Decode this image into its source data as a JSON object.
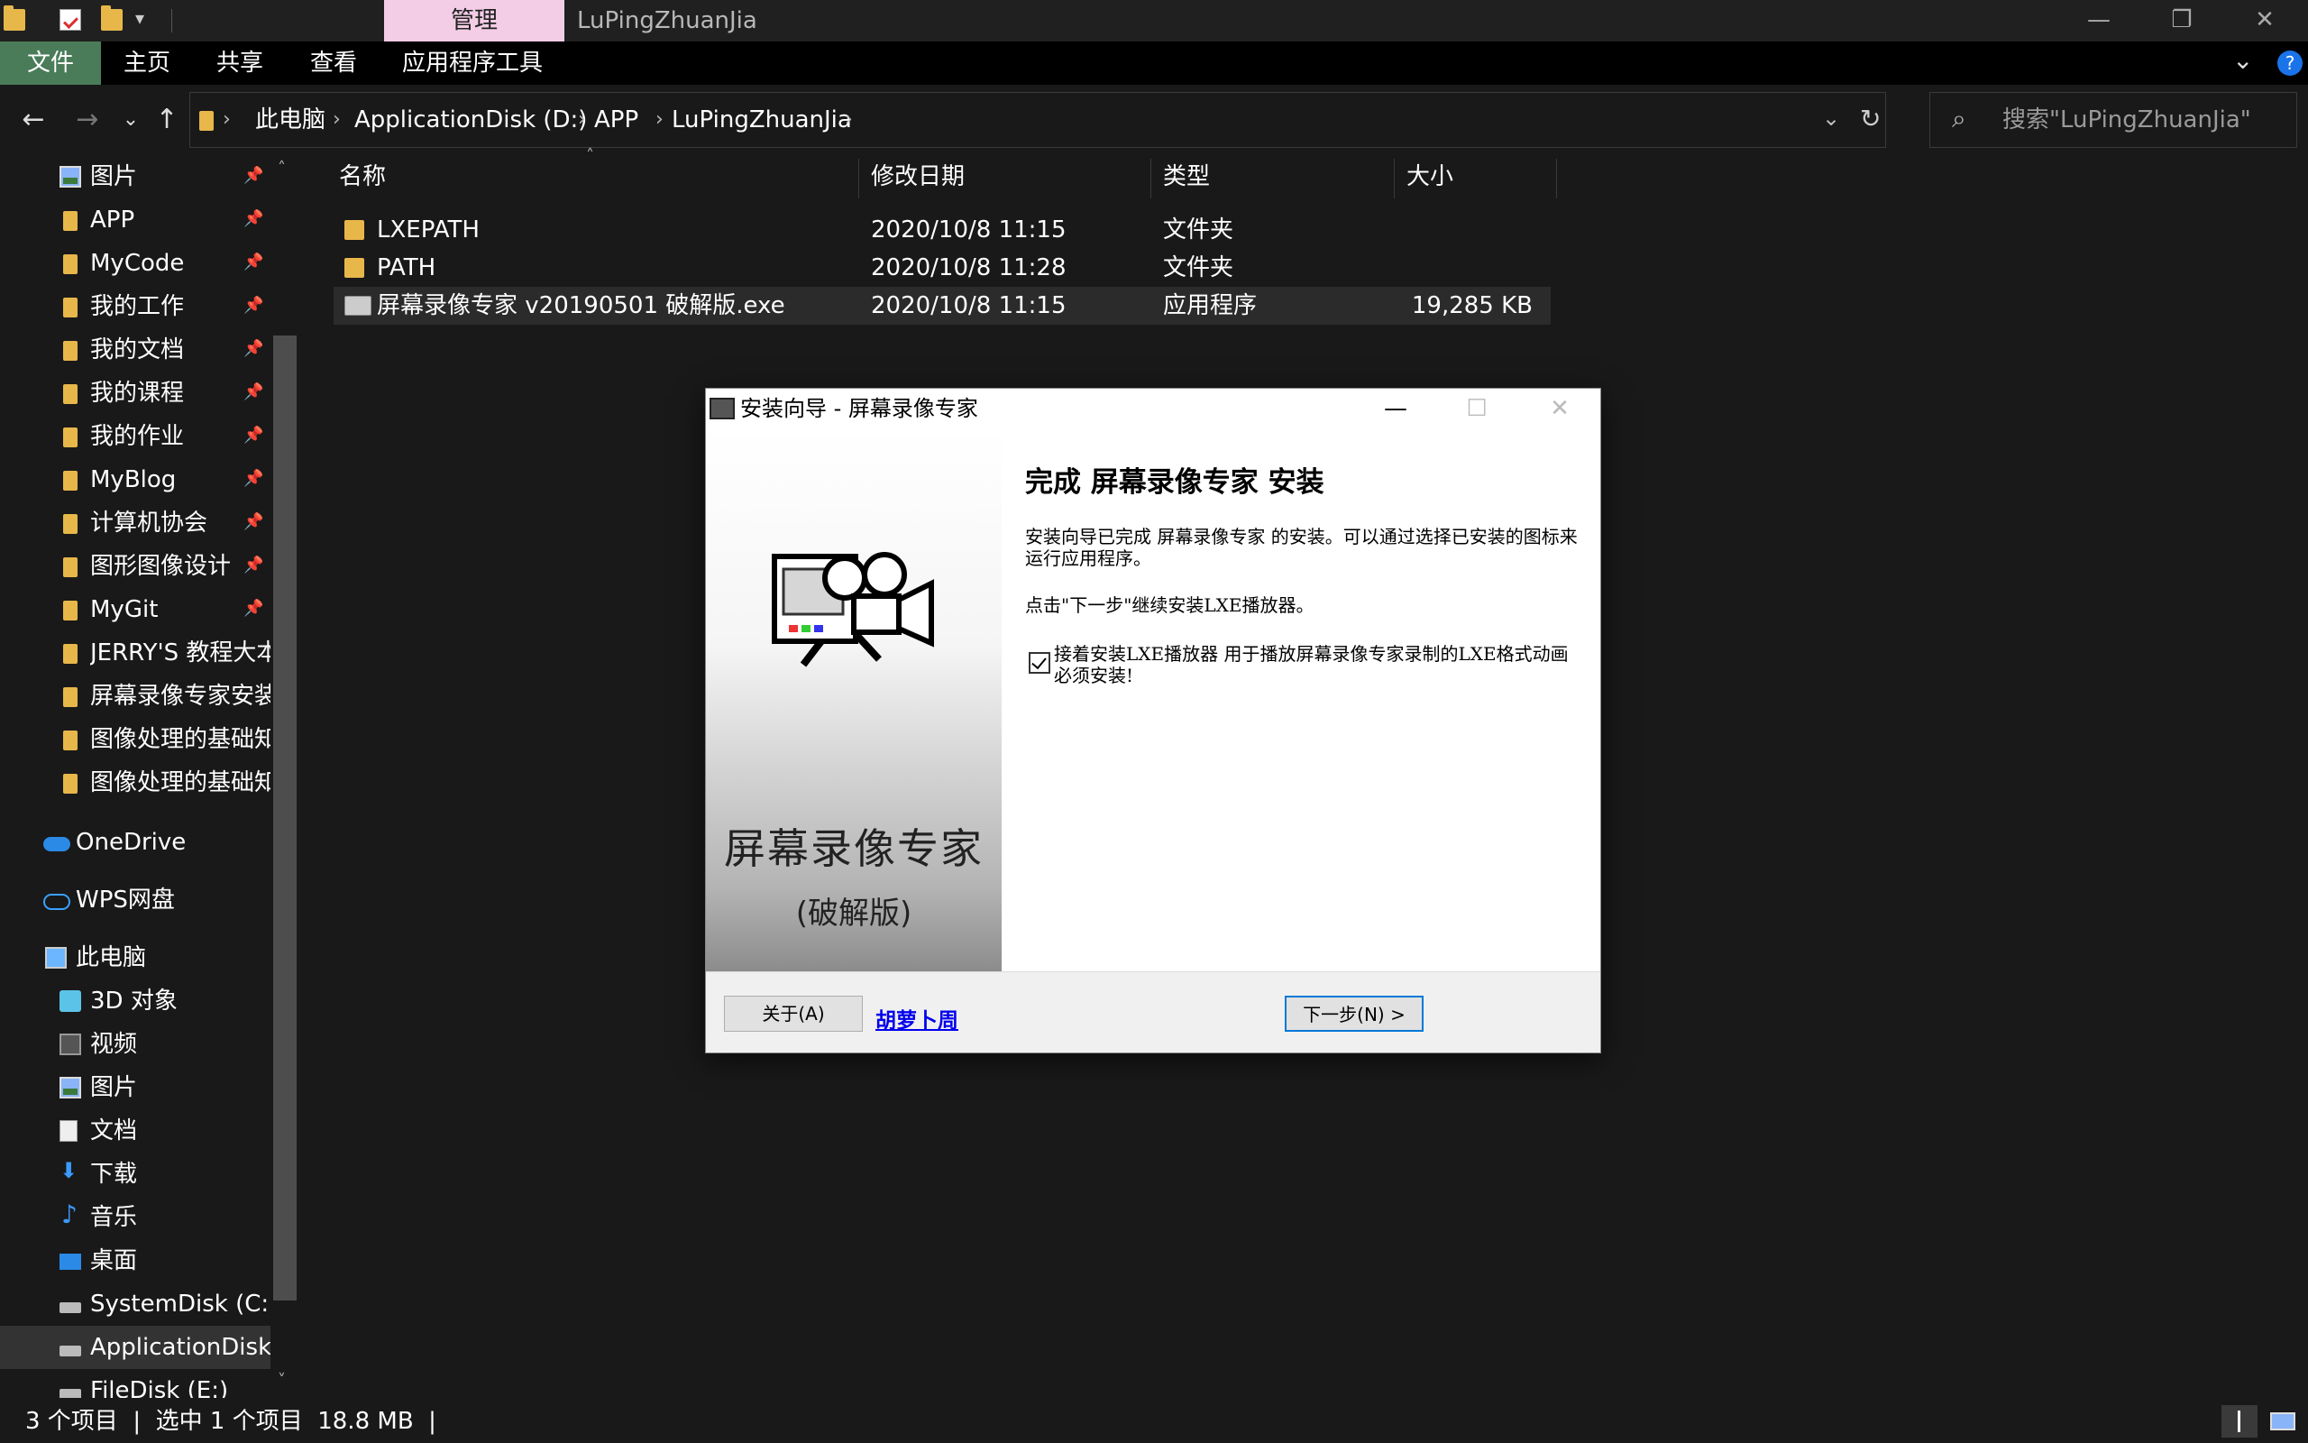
{
  "titlebar": {
    "manage_tab": "管理",
    "window_title": "LuPingZhuanJia",
    "minimize": "—",
    "maximize": "❐",
    "close": "✕"
  },
  "ribbon": {
    "tabs": [
      "文件",
      "主页",
      "共享",
      "查看",
      "应用程序工具"
    ],
    "expand_icon": "chevron-down-icon",
    "help": "?"
  },
  "address": {
    "crumbs": [
      "此电脑",
      "ApplicationDisk (D:)",
      "APP",
      "LuPingZhuanJia"
    ],
    "search_placeholder": "搜索\"LuPingZhuanJia\""
  },
  "sidebar": {
    "items": [
      {
        "label": "图片",
        "icon": "pictures-icon",
        "pinned": true
      },
      {
        "label": "APP",
        "icon": "folder-icon",
        "pinned": true
      },
      {
        "label": "MyCode",
        "icon": "folder-icon",
        "pinned": true
      },
      {
        "label": "我的工作",
        "icon": "folder-icon",
        "pinned": true
      },
      {
        "label": "我的文档",
        "icon": "folder-icon",
        "pinned": true
      },
      {
        "label": "我的课程",
        "icon": "folder-icon",
        "pinned": true
      },
      {
        "label": "我的作业",
        "icon": "folder-icon",
        "pinned": true
      },
      {
        "label": "MyBlog",
        "icon": "folder-icon",
        "pinned": true
      },
      {
        "label": "计算机协会",
        "icon": "folder-icon",
        "pinned": true
      },
      {
        "label": "图形图像设计",
        "icon": "folder-icon",
        "pinned": true
      },
      {
        "label": "MyGit",
        "icon": "folder-icon",
        "pinned": true
      },
      {
        "label": "JERRY'S 教程大本营",
        "icon": "folder-icon",
        "pinned": false
      },
      {
        "label": "屏幕录像专家安装前",
        "icon": "folder-icon",
        "pinned": false
      },
      {
        "label": "图像处理的基础知识",
        "icon": "folder-icon",
        "pinned": false
      },
      {
        "label": "图像处理的基础知识",
        "icon": "folder-icon",
        "pinned": false
      }
    ],
    "onedrive": "OneDrive",
    "wps": "WPS网盘",
    "this_pc": "此电脑",
    "pc_items": [
      {
        "label": "3D 对象",
        "icon": "3d-objects-icon"
      },
      {
        "label": "视频",
        "icon": "videos-icon"
      },
      {
        "label": "图片",
        "icon": "pictures-icon"
      },
      {
        "label": "文档",
        "icon": "documents-icon"
      },
      {
        "label": "下载",
        "icon": "downloads-icon"
      },
      {
        "label": "音乐",
        "icon": "music-icon"
      },
      {
        "label": "桌面",
        "icon": "desktop-icon"
      },
      {
        "label": "SystemDisk (C:)",
        "icon": "drive-icon"
      },
      {
        "label": "ApplicationDisk (D:)",
        "icon": "drive-icon"
      },
      {
        "label": "FileDisk (E:)",
        "icon": "drive-icon"
      }
    ]
  },
  "filelist": {
    "columns": [
      "名称",
      "修改日期",
      "类型",
      "大小"
    ],
    "rows": [
      {
        "name": "LXEPATH",
        "date": "2020/10/8 11:15",
        "type": "文件夹",
        "size": ""
      },
      {
        "name": "PATH",
        "date": "2020/10/8 11:28",
        "type": "文件夹",
        "size": ""
      },
      {
        "name": "屏幕录像专家 v20190501 破解版.exe",
        "date": "2020/10/8 11:15",
        "type": "应用程序",
        "size": "19,285 KB"
      }
    ]
  },
  "status": {
    "text": "3 个项目  |  选中 1 个项目  18.8 MB  |"
  },
  "dialog": {
    "title": "安装向导 - 屏幕录像专家",
    "banner_name": "屏幕录像专家",
    "banner_sub": "(破解版)",
    "heading": "完成 屏幕录像专家 安装",
    "para1": "安装向导已完成 屏幕录像专家 的安装。可以通过选择已安装的图标来运行应用程序。",
    "para2": "点击\"下一步\"继续安装LXE播放器。",
    "checkbox_label": "接着安装LXE播放器 用于播放屏幕录像专家录制的LXE格式动画 必须安装!",
    "checkbox_checked": true,
    "about_button": "关于(A)",
    "link": "胡萝卜周",
    "next_button": "下一步(N) >"
  }
}
